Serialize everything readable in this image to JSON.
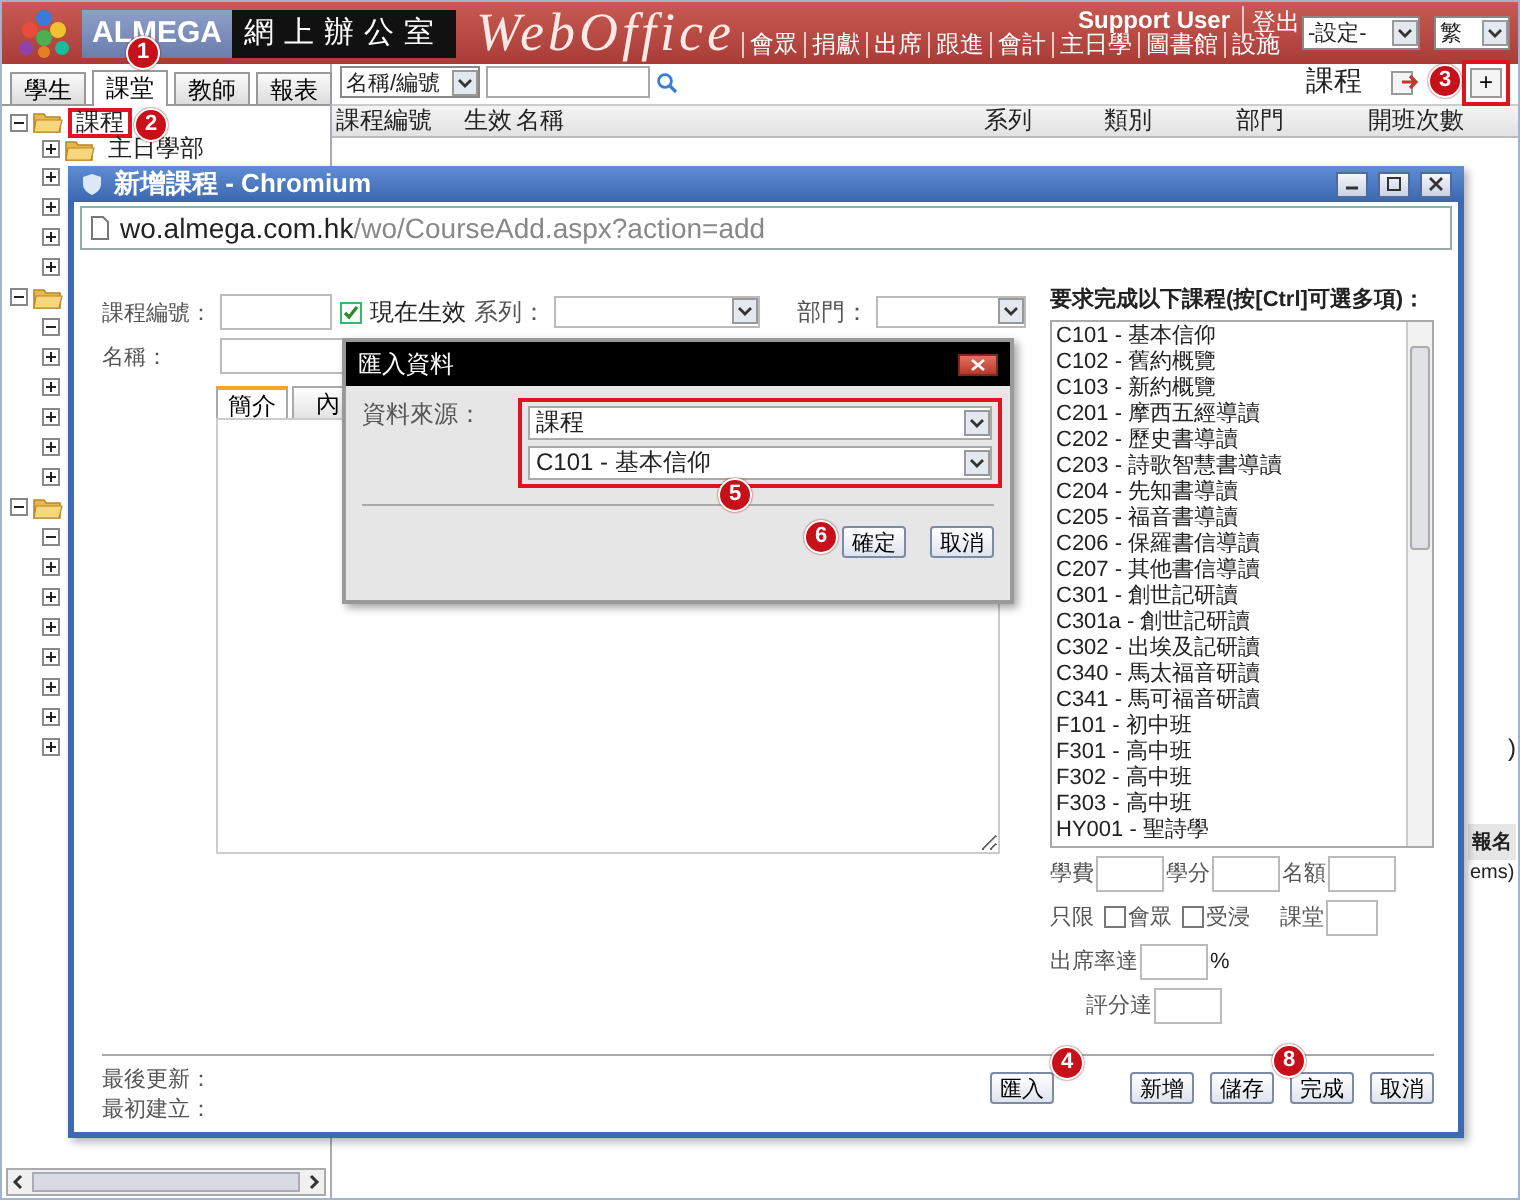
{
  "header": {
    "brand": "ALMEGA",
    "title": "網上辦公室",
    "product": "WebOffice",
    "user": "Support User",
    "logout": "登出",
    "nav": [
      "會眾",
      "捐獻",
      "出席",
      "跟進",
      "會計",
      "主日學",
      "圖書館",
      "設施"
    ],
    "settings_select": "-設定-",
    "language_select": "繁"
  },
  "side_tabs": [
    {
      "label": "學生",
      "selected": false
    },
    {
      "label": "課堂",
      "selected": true,
      "callout": "1"
    },
    {
      "label": "教師",
      "selected": false
    },
    {
      "label": "報表",
      "selected": false
    }
  ],
  "tree": [
    {
      "kind": "folder",
      "label": "課程",
      "expanded": true,
      "highlighted": true,
      "callout": "2",
      "children": [
        {
          "kind": "folder",
          "label": "主日學部",
          "expanded": false
        },
        {
          "kind": "node",
          "expanded": false
        },
        {
          "kind": "node",
          "expanded": false
        },
        {
          "kind": "node",
          "expanded": false
        },
        {
          "kind": "node",
          "expanded": false
        }
      ]
    },
    {
      "kind": "folder",
      "expanded": true,
      "children": [
        {
          "kind": "node",
          "expanded": true
        },
        {
          "kind": "node",
          "expanded": false
        },
        {
          "kind": "node",
          "expanded": false
        },
        {
          "kind": "node",
          "expanded": false
        },
        {
          "kind": "node",
          "expanded": false
        },
        {
          "kind": "node",
          "expanded": false
        }
      ]
    },
    {
      "kind": "folder",
      "expanded": true,
      "children": [
        {
          "kind": "node",
          "expanded": true
        },
        {
          "kind": "node",
          "expanded": false
        },
        {
          "kind": "node",
          "expanded": false
        },
        {
          "kind": "node",
          "expanded": false
        },
        {
          "kind": "node",
          "expanded": false
        },
        {
          "kind": "node",
          "expanded": false
        },
        {
          "kind": "node",
          "expanded": false
        },
        {
          "kind": "node",
          "expanded": false
        }
      ]
    }
  ],
  "toolbar": {
    "search_by": "名稱/編號",
    "section_title": "課程",
    "add_button": {
      "label": "+",
      "highlighted": true,
      "callout": "3"
    }
  },
  "table": {
    "columns": [
      "課程編號",
      "生效",
      "名稱",
      "系列",
      "類別",
      "部門",
      "開班次數"
    ]
  },
  "background_fragments": {
    "header_cell": "報名",
    "text": "ems)",
    "mark": ")"
  },
  "popup": {
    "title": "新增課程 - Chromium",
    "url_host": "wo.almega.com.hk",
    "url_path": "/wo/CourseAdd.aspx?action=add",
    "code_label": "課程編號：",
    "active": {
      "label": "現在生效",
      "checked": true
    },
    "series_label": "系列：",
    "department_label": "部門：",
    "name_label": "名稱：",
    "tabs": [
      {
        "label": "簡介",
        "selected": true
      },
      {
        "label": "內",
        "selected": false
      }
    ],
    "prereq_label": "要求完成以下課程(按[Ctrl]可選多項)：",
    "prereq_options": [
      "C101 - 基本信仰",
      "C102 - 舊約概覽",
      "C103 - 新約概覽",
      "C201 - 摩西五經導讀",
      "C202 - 歷史書導讀",
      "C203 - 詩歌智慧書導讀",
      "C204 - 先知書導讀",
      "C205 - 福音書導讀",
      "C206 - 保羅書信導讀",
      "C207 - 其他書信導讀",
      "C301 - 創世記研讀",
      "C301a - 創世記研讀",
      "C302 - 出埃及記研讀",
      "C340 - 馬太福音研讀",
      "C341 - 馬可福音研讀",
      "F101 - 初中班",
      "F301 - 高中班",
      "F302 - 高中班",
      "F303 - 高中班",
      "HY001 - 聖詩學"
    ],
    "fee_label": "學費",
    "credit_label": "學分",
    "quota_label": "名額",
    "only_label": "只限",
    "only_options": [
      {
        "label": "會眾",
        "checked": false
      },
      {
        "label": "受浸",
        "checked": false
      }
    ],
    "room_label": "課堂",
    "attendance_label": "出席率達",
    "percent": "%",
    "score_label": "評分達",
    "updated_label": "最後更新：",
    "created_label": "最初建立：",
    "buttons": [
      {
        "label": "匯入",
        "callout": "4"
      },
      {
        "label": "新增"
      },
      {
        "label": "儲存"
      },
      {
        "label": "完成",
        "callout": "8"
      },
      {
        "label": "取消"
      }
    ]
  },
  "dialog": {
    "title": "匯入資料",
    "source_label": "資料來源：",
    "selects": [
      "課程",
      "C101 - 基本信仰"
    ],
    "highlighted": true,
    "callout": "5",
    "buttons": [
      {
        "label": "確定",
        "callout": "6"
      },
      {
        "label": "取消"
      }
    ]
  }
}
